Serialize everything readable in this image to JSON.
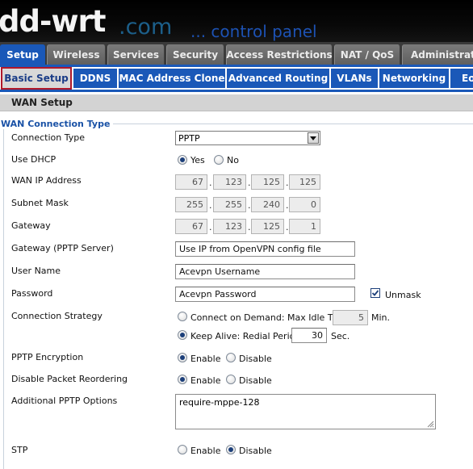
{
  "header": {
    "logo_main": "dd-wrt",
    "logo_dotcom": ".com",
    "logo_subtitle": "... control panel"
  },
  "main_tabs": [
    {
      "label": "Setup",
      "active": true
    },
    {
      "label": "Wireless"
    },
    {
      "label": "Services"
    },
    {
      "label": "Security"
    },
    {
      "label": "Access Restrictions"
    },
    {
      "label": "NAT / QoS"
    },
    {
      "label": "Administration"
    }
  ],
  "sub_tabs": [
    {
      "label": "Basic Setup",
      "active": true
    },
    {
      "label": "DDNS"
    },
    {
      "label": "MAC Address Clone"
    },
    {
      "label": "Advanced Routing"
    },
    {
      "label": "VLANs"
    },
    {
      "label": "Networking"
    },
    {
      "label": "Eo"
    }
  ],
  "section_title": "WAN Setup",
  "fieldset_legend": "WAN Connection Type",
  "form": {
    "connection_type": {
      "label": "Connection Type",
      "value": "PPTP"
    },
    "use_dhcp": {
      "label": "Use DHCP",
      "yes": "Yes",
      "no": "No",
      "selected": "yes"
    },
    "wan_ip": {
      "label": "WAN IP Address",
      "octets": [
        "67",
        "123",
        "125",
        "125"
      ]
    },
    "subnet_mask": {
      "label": "Subnet Mask",
      "octets": [
        "255",
        "255",
        "240",
        "0"
      ]
    },
    "gateway": {
      "label": "Gateway",
      "octets": [
        "67",
        "123",
        "125",
        "1"
      ]
    },
    "pptp_server": {
      "label": "Gateway (PPTP Server)",
      "value": "Use IP from OpenVPN config file"
    },
    "user_name": {
      "label": "User Name",
      "value": "Acevpn Username"
    },
    "password": {
      "label": "Password",
      "value": "Acevpn Password",
      "unmask_label": "Unmask",
      "unmask_checked": true
    },
    "connection_strategy": {
      "label": "Connection Strategy",
      "on_demand_label": "Connect on Demand: Max Idle Time",
      "on_demand_value": "5",
      "on_demand_unit": "Min.",
      "keep_alive_label": "Keep Alive: Redial Period",
      "keep_alive_value": "30",
      "keep_alive_unit": "Sec.",
      "selected": "keep_alive"
    },
    "pptp_encryption": {
      "label": "PPTP Encryption",
      "enable": "Enable",
      "disable": "Disable",
      "selected": "enable"
    },
    "packet_reordering": {
      "label": "Disable Packet Reordering",
      "enable": "Enable",
      "disable": "Disable",
      "selected": "enable"
    },
    "pptp_options": {
      "label": "Additional PPTP Options",
      "value": "require-mppe-128"
    },
    "stp": {
      "label": "STP",
      "enable": "Enable",
      "disable": "Disable",
      "selected": "disable"
    }
  }
}
